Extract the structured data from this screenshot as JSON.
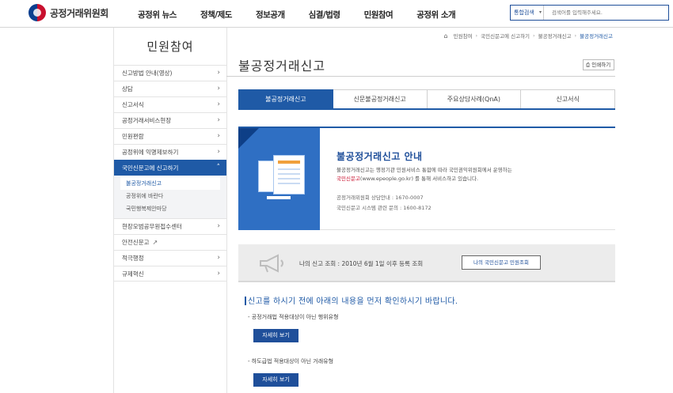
{
  "header": {
    "logo_text": "공정거래위원회",
    "menu": [
      "공정위 뉴스",
      "정책/제도",
      "정보공개",
      "심결/법령",
      "민원참여",
      "공정위 소개"
    ],
    "search": {
      "scope": "통합검색",
      "placeholder": "검색어를 입력해주세요."
    }
  },
  "sidebar": {
    "title": "민원참여",
    "items": [
      {
        "label": "신고방법 안내(영상)"
      },
      {
        "label": "상담"
      },
      {
        "label": "신고서식"
      },
      {
        "label": "공정거래서비스현장"
      },
      {
        "label": "민원편람"
      },
      {
        "label": "공정위에 익명제보하기"
      },
      {
        "label": "국민신문고에 신고하기"
      }
    ],
    "sub": [
      "불공정거래신고",
      "공정위에 바란다",
      "국민행복제안마당"
    ],
    "items_after": [
      {
        "label": "현장모범공무원접수센터"
      },
      {
        "label": "안전신문고"
      },
      {
        "label": "적극행정"
      },
      {
        "label": "규제혁신"
      }
    ]
  },
  "breadcrumb": [
    "민원참여",
    "국민신문고에 신고하기",
    "불공정거래신고",
    "불공정거래신고"
  ],
  "page_title": "불공정거래신고",
  "print_label": "인쇄하기",
  "tabs": [
    "불공정거래신고",
    "신문불공정거래신고",
    "주요상담사례(QnA)",
    "신고서식"
  ],
  "guide": {
    "title": "불공정거래신고 안내",
    "line1": "불공정거래신고는 행정기관 민원서비스 통합에 따라 국민권익위원회에서 운영하는",
    "link": "국민신문고",
    "line2": "(www.epeople.go.kr) 를 통해 서비스하고 있습니다.",
    "contact1": "공정거래위원회 상담안내 : 1670-0007",
    "contact2": "국민신문고 시스템 관련 문의 : 1600-8172"
  },
  "my_report": {
    "text": "나의 신고 조회 : 2010년 6월 1일 이후 등록 조회",
    "button": "나의 국민신문고 민원조회"
  },
  "notice": {
    "heading": "신고를 하시기 전에 아래의 내용을 먼저 확인하시기 바랍니다.",
    "item1": "공정거래법 적용대상이 아닌 행위유형",
    "item2": "하도급법 적용대상이 아닌 거래유형",
    "more": "자세히 보기"
  }
}
